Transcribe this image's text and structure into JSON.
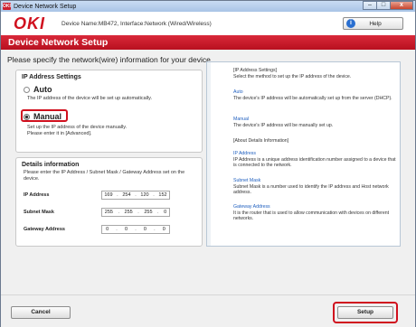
{
  "window": {
    "title": "Device Network Setup",
    "app_icon_text": "OKI",
    "controls": [
      "–",
      "□",
      "x"
    ]
  },
  "header": {
    "logo": "OKI",
    "device_name": "Device Name:MB472, Interface:Network (Wired/Wireless)",
    "help_label": "Help"
  },
  "banner": {
    "title": "Device Network Setup"
  },
  "instruction": "Please specify the network(wire) information for your device.",
  "ip_settings": {
    "title": "IP Address Settings",
    "auto": {
      "label": "Auto",
      "description": "The IP address of the device will be set up automatically.",
      "selected": false
    },
    "manual": {
      "label": "Manual",
      "description_line1": "Set up the IP address of the device manually.",
      "description_line2": "Please enter it in [Advanced].",
      "selected": true
    }
  },
  "details": {
    "title": "Details information",
    "description": "Please enter the IP Address / Subnet Mask / Gateway Address set on the device.",
    "fields": [
      {
        "label": "IP Address",
        "octets": [
          "169",
          "254",
          "120",
          "152"
        ]
      },
      {
        "label": "Subnet Mask",
        "octets": [
          "255",
          "255",
          "255",
          "0"
        ]
      },
      {
        "label": "Gateway Address",
        "octets": [
          "0",
          "0",
          "0",
          "0"
        ]
      }
    ]
  },
  "help_panel": {
    "settings_heading": "[IP Address Settings]",
    "settings_text": "Select the method to set up the IP address of the device.",
    "auto_heading": "Auto",
    "auto_text": "The device's IP address will be automatically set up from the server (DHCP).",
    "manual_heading": "Manual",
    "manual_text": "The device's IP address will be manually set up.",
    "details_heading": "[About Details Information]",
    "ip_heading": "IP Address",
    "ip_text": "IP Address is a unique address identification number assigned to a device that is connected to the network.",
    "subnet_heading": "Subnet Mask",
    "subnet_text": "Subnet Mask is a number used to identify the IP address and Host network address.",
    "gateway_heading": "Gateway Address",
    "gateway_text": "It is the router that is used to allow communication with devices on different networks."
  },
  "footer": {
    "cancel_label": "Cancel",
    "setup_label": "Setup"
  },
  "colors": {
    "brand_red": "#d0101e",
    "link_blue": "#1f5fbf"
  }
}
